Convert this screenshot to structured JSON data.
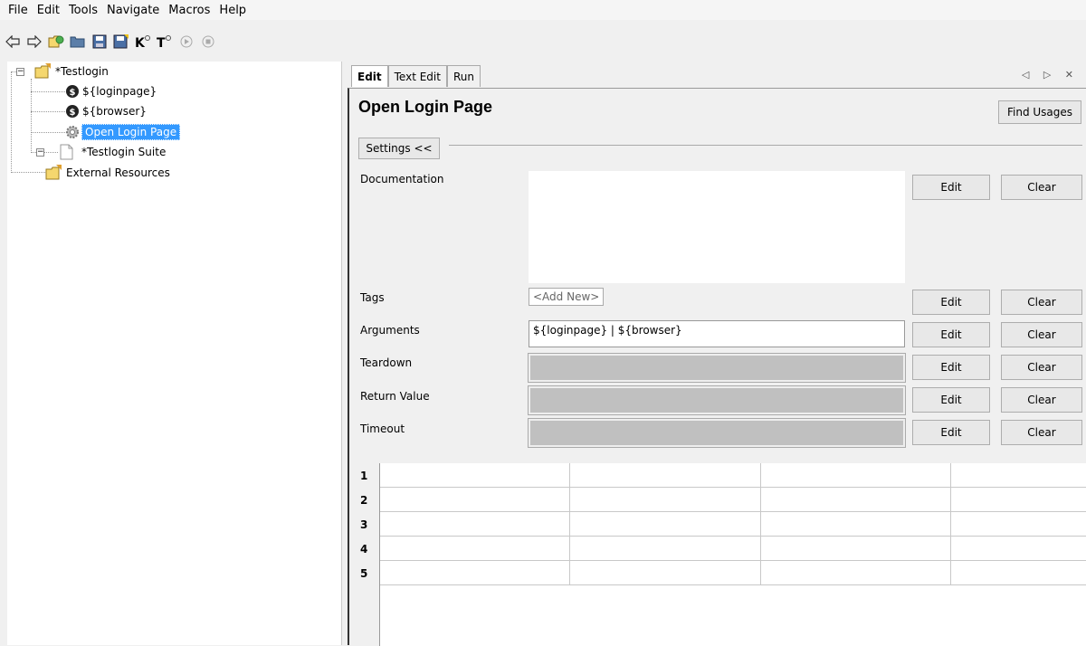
{
  "menu": [
    "File",
    "Edit",
    "Tools",
    "Navigate",
    "Macros",
    "Help"
  ],
  "toolbar_icons": [
    "back-arrow-icon",
    "forward-arrow-icon",
    "open-project-icon",
    "open-folder-icon",
    "save-icon",
    "save-all-icon",
    "search-keyword-icon",
    "search-test-icon",
    "run-icon",
    "stop-icon"
  ],
  "tree": {
    "root": "*Testlogin",
    "items": [
      "${loginpage}",
      "${browser}",
      "Open Login Page"
    ],
    "suite": "*Testlogin Suite",
    "external": "External Resources"
  },
  "tabs": [
    "Edit",
    "Text Edit",
    "Run"
  ],
  "tab_nav": "◁ ▷ ✕",
  "editor": {
    "title": "Open Login Page",
    "find_usages": "Find Usages",
    "settings_toggle": "Settings <<",
    "fields": {
      "documentation": {
        "label": "Documentation",
        "value": ""
      },
      "tags": {
        "label": "Tags",
        "placeholder": "<Add New>"
      },
      "arguments": {
        "label": "Arguments",
        "value": "${loginpage} | ${browser}"
      },
      "teardown": {
        "label": "Teardown",
        "value": ""
      },
      "return_value": {
        "label": "Return Value",
        "value": ""
      },
      "timeout": {
        "label": "Timeout",
        "value": ""
      }
    },
    "edit_label": "Edit",
    "clear_label": "Clear"
  },
  "grid": {
    "rows": [
      "1",
      "2",
      "3",
      "4",
      "5"
    ]
  }
}
